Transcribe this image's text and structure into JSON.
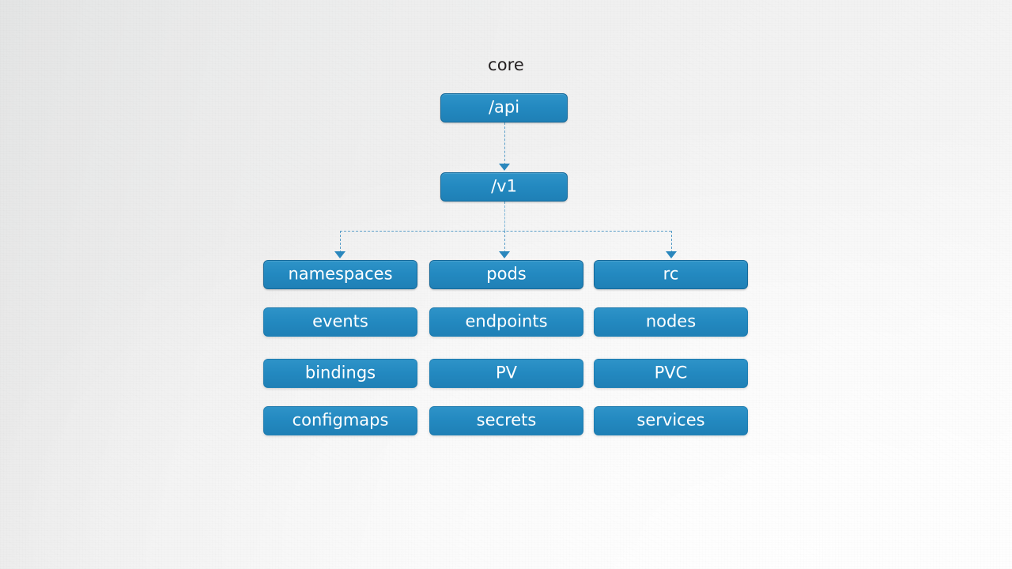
{
  "diagram": {
    "title": "core",
    "type": "tree",
    "colors": {
      "node_fill": "#2389c0",
      "node_border": "#15699a",
      "node_text": "#ffffff",
      "connector": "#5b9fc9",
      "arrowhead": "#2a87bd",
      "title_text": "#231f20",
      "background": "#f1f1f1"
    },
    "root": {
      "id": "api",
      "label": "/api"
    },
    "version": {
      "id": "v1",
      "label": "/v1"
    },
    "columns": [
      {
        "id": "column-1",
        "head": "namespaces",
        "nodes": [
          {
            "id": "namespaces",
            "label": "namespaces",
            "linked": true
          },
          {
            "id": "events",
            "label": "events",
            "linked": false
          },
          {
            "id": "bindings",
            "label": "bindings",
            "linked": false
          },
          {
            "id": "configmaps",
            "label": "configmaps",
            "linked": false
          }
        ]
      },
      {
        "id": "column-2",
        "head": "pods",
        "nodes": [
          {
            "id": "pods",
            "label": "pods",
            "linked": true
          },
          {
            "id": "endpoints",
            "label": "endpoints",
            "linked": false
          },
          {
            "id": "pv",
            "label": "PV",
            "linked": false
          },
          {
            "id": "secrets",
            "label": "secrets",
            "linked": false
          }
        ]
      },
      {
        "id": "column-3",
        "head": "rc",
        "nodes": [
          {
            "id": "rc",
            "label": "rc",
            "linked": true
          },
          {
            "id": "nodes",
            "label": "nodes",
            "linked": false
          },
          {
            "id": "pvc",
            "label": "PVC",
            "linked": false
          },
          {
            "id": "services",
            "label": "services",
            "linked": false
          }
        ]
      }
    ],
    "edges": [
      {
        "from": "/api",
        "to": "/v1",
        "style": "dashed",
        "arrow": "triangle"
      },
      {
        "from": "/v1",
        "to": "namespaces",
        "style": "dashed",
        "arrow": "triangle"
      },
      {
        "from": "/v1",
        "to": "pods",
        "style": "dashed",
        "arrow": "triangle"
      },
      {
        "from": "/v1",
        "to": "rc",
        "style": "dashed",
        "arrow": "triangle"
      }
    ]
  }
}
